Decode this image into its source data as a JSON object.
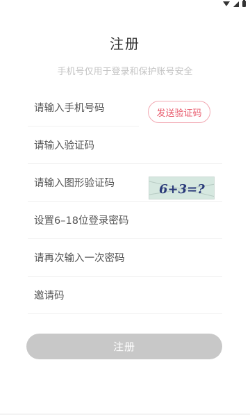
{
  "header": {
    "title": "注册",
    "subtitle": "手机号仅用于登录和保护账号安全"
  },
  "form": {
    "phone_placeholder": "请输入手机号码",
    "send_code_label": "发送验证码",
    "sms_code_placeholder": "请输入验证码",
    "image_code_placeholder": "请输入图形验证码",
    "captcha_text": "6+3=?",
    "password_placeholder": "设置6–18位登录密码",
    "confirm_password_placeholder": "请再次输入一次密码",
    "invite_code_placeholder": "邀请码",
    "submit_label": "注册"
  },
  "colors": {
    "accent": "#e85a6c",
    "button_disabled": "#c8c8c8",
    "captcha_bg": "#d6e8e0",
    "captcha_text": "#2a3a7a"
  },
  "icons": [
    "wifi-icon",
    "signal-icon",
    "battery-icon"
  ]
}
